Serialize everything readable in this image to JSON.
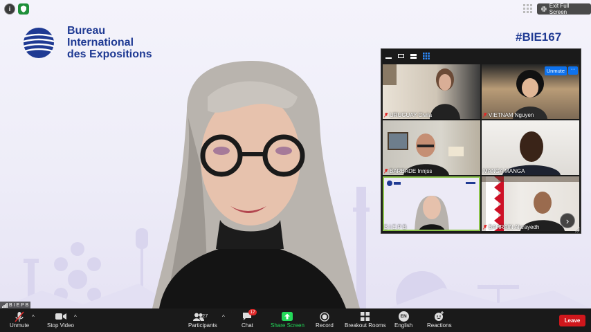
{
  "window": {
    "exit_full_screen": "Exit Full Screen"
  },
  "branding": {
    "logo_line1": "Bureau",
    "logo_line2": "International",
    "logo_line3": "des Expositions",
    "hashtag": "#BIE167"
  },
  "main_video": {
    "speaker_label": "B I E P B"
  },
  "gallery": {
    "unmute_label": "Unmute",
    "more_label": "···",
    "tiles": [
      {
        "name": "URUGUAY Civila",
        "muted": true
      },
      {
        "name": "VIETNAM Nguyen",
        "muted": true
      },
      {
        "name": "BARBADE Innjss",
        "muted": true
      },
      {
        "name": "MANGA MANGA",
        "muted": false
      },
      {
        "name": "B I E P B",
        "muted": false
      },
      {
        "name": "BAHRAIN Alarayedh",
        "muted": true
      }
    ]
  },
  "toolbar": {
    "unmute": "Unmute",
    "stop_video": "Stop Video",
    "participants": "Participants",
    "participants_count": "127",
    "chat": "Chat",
    "chat_badge": "17",
    "share_screen": "Share Screen",
    "record": "Record",
    "breakout_rooms": "Breakout Rooms",
    "language_code": "EN",
    "language": "English",
    "reactions": "Reactions",
    "leave": "Leave"
  },
  "colors": {
    "brand_blue": "#1f3a93",
    "share_green": "#23d959",
    "leave_red": "#d0171c",
    "unmute_blue": "#0e72ed",
    "toolbar_bg": "#1a1a1a"
  }
}
